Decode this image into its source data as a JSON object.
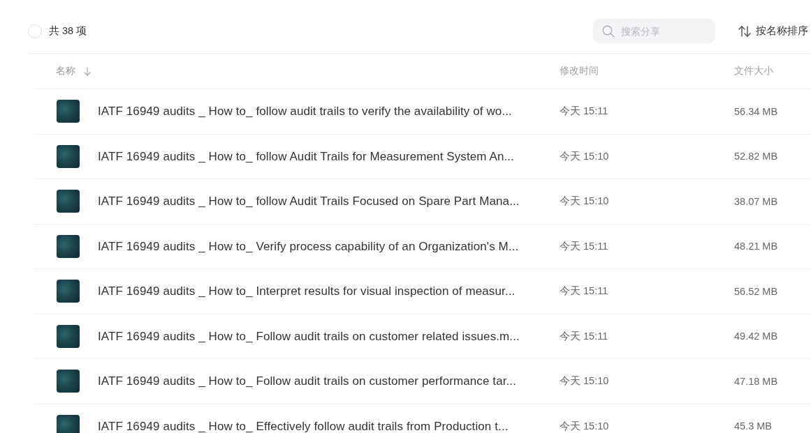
{
  "toolbar": {
    "select_all": {
      "checked": false
    },
    "count": "共 38 项",
    "search": {
      "placeholder": "搜索分享"
    },
    "sort_button": "按名称排序"
  },
  "table": {
    "columns": [
      {
        "label": "名称",
        "sorted": true
      },
      {
        "label": "修改时间",
        "sorted": false
      },
      {
        "label": "文件大小",
        "sorted": false
      }
    ],
    "rows": [
      {
        "name": "IATF 16949 audits _ How to_ follow audit trails to verify the availability of wo...",
        "modified": "今天 15:11",
        "size": "56.34 MB"
      },
      {
        "name": "IATF 16949 audits _ How to_ follow Audit Trails for Measurement System An...",
        "modified": "今天 15:10",
        "size": "52.82 MB"
      },
      {
        "name": "IATF 16949 audits _ How to_ follow Audit Trails Focused on Spare Part Mana...",
        "modified": "今天 15:10",
        "size": "38.07 MB"
      },
      {
        "name": "IATF 16949 audits _ How to_ Verify process capability of an Organization's M...",
        "modified": "今天 15:11",
        "size": "48.21 MB"
      },
      {
        "name": "IATF 16949 audits _ How to_ Interpret results for visual inspection of measur...",
        "modified": "今天 15:11",
        "size": "56.52 MB"
      },
      {
        "name": "IATF 16949 audits _ How to_ Follow audit trails on customer related issues.m...",
        "modified": "今天 15:11",
        "size": "49.42 MB"
      },
      {
        "name": "IATF 16949 audits _ How to_ Follow audit trails on customer performance tar...",
        "modified": "今天 15:10",
        "size": "47.18 MB"
      },
      {
        "name": "IATF 16949 audits _ How to_ Effectively follow audit trails from Production t...",
        "modified": "今天 15:10",
        "size": "45.3 MB"
      }
    ]
  }
}
